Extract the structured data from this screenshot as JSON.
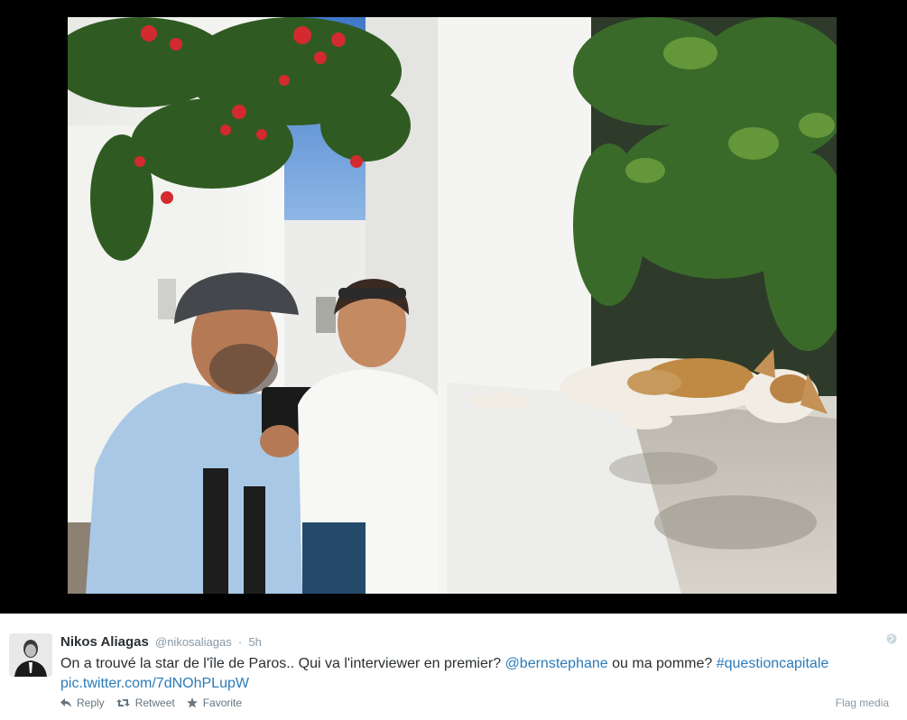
{
  "media": {
    "icon": "photo-media"
  },
  "tweet": {
    "fullname": "Nikos Aliagas",
    "username": "@nikosaliagas",
    "separator": "·",
    "timestamp": "5h",
    "text_main": "On a trouvé la star de l'île de Paros.. Qui va l'interviewer en premier? ",
    "mention": "@bernstephane",
    "text_mid": " ou ma pomme? ",
    "hashtag": "#questioncapitale",
    "pic_link": "pic.twitter.com/7dNOhPLupW"
  },
  "actions": {
    "reply_label": "Reply",
    "retweet_label": "Retweet",
    "favorite_label": "Favorite",
    "flag_label": "Flag media"
  },
  "colors": {
    "link": "#2b7bb9",
    "text": "#292f33",
    "muted": "#8899a6"
  }
}
